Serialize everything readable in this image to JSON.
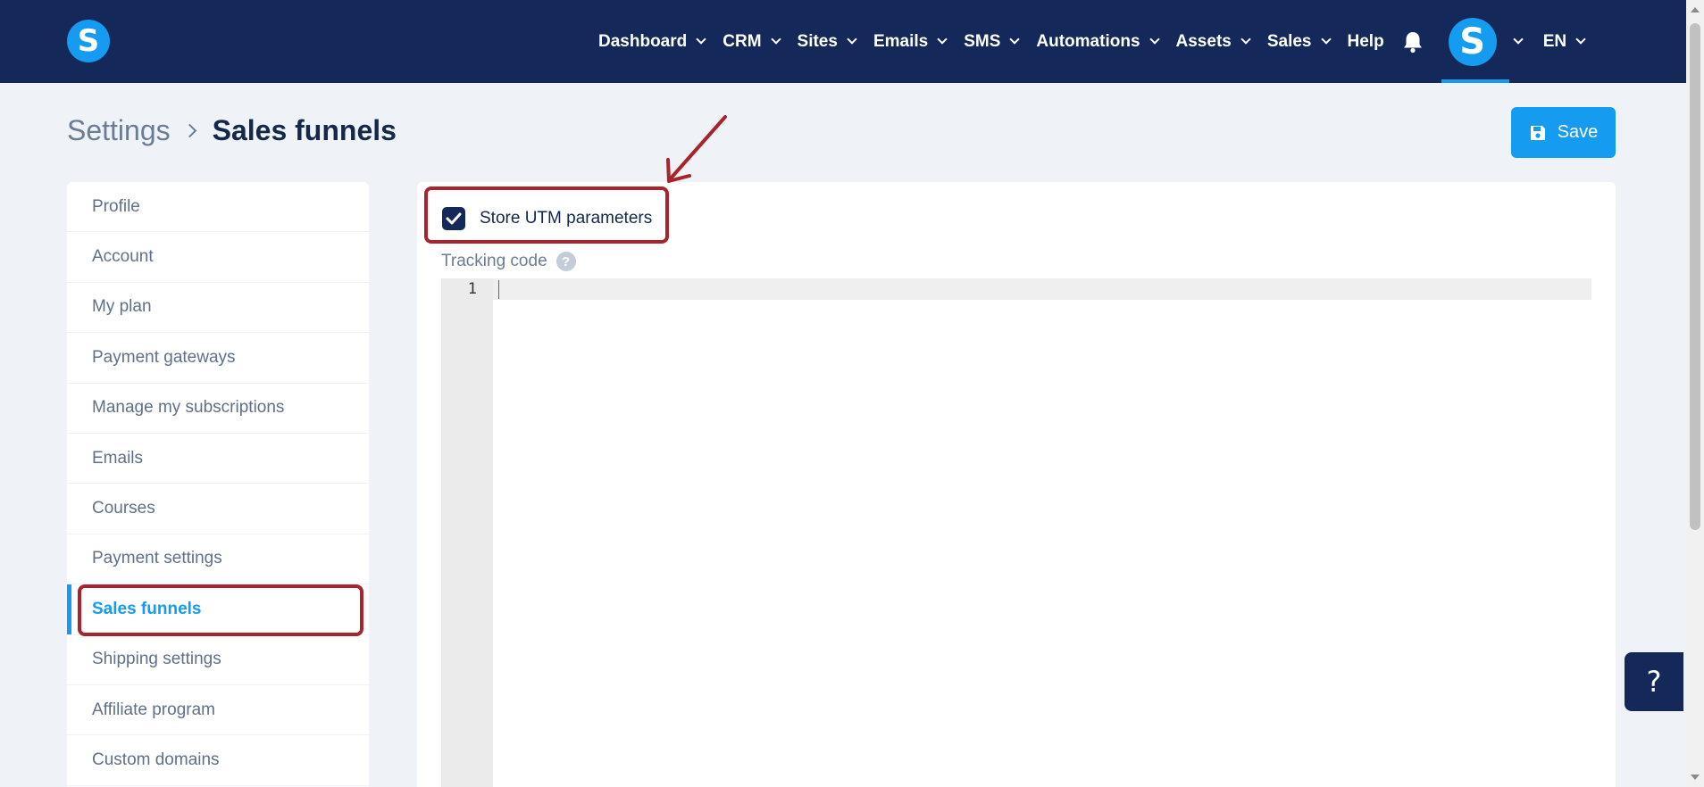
{
  "header": {
    "logo_letter": "S",
    "nav": [
      {
        "label": "Dashboard",
        "dropdown": true
      },
      {
        "label": "CRM",
        "dropdown": true
      },
      {
        "label": "Sites",
        "dropdown": true
      },
      {
        "label": "Emails",
        "dropdown": true
      },
      {
        "label": "SMS",
        "dropdown": true
      },
      {
        "label": "Automations",
        "dropdown": true
      },
      {
        "label": "Assets",
        "dropdown": true
      },
      {
        "label": "Sales",
        "dropdown": true
      },
      {
        "label": "Help",
        "dropdown": false
      }
    ],
    "notification_icon": "bell-icon",
    "avatar_letter": "S",
    "language": "EN"
  },
  "breadcrumb": {
    "parent": "Settings",
    "current": "Sales funnels"
  },
  "toolbar": {
    "save_label": "Save",
    "save_icon": "floppy-disk-icon"
  },
  "sidebar": {
    "items": [
      {
        "label": "Profile",
        "active": false
      },
      {
        "label": "Account",
        "active": false
      },
      {
        "label": "My plan",
        "active": false
      },
      {
        "label": "Payment gateways",
        "active": false
      },
      {
        "label": "Manage my subscriptions",
        "active": false
      },
      {
        "label": "Emails",
        "active": false
      },
      {
        "label": "Courses",
        "active": false
      },
      {
        "label": "Payment settings",
        "active": false
      },
      {
        "label": "Sales funnels",
        "active": true
      },
      {
        "label": "Shipping settings",
        "active": false
      },
      {
        "label": "Affiliate program",
        "active": false
      },
      {
        "label": "Custom domains",
        "active": false
      }
    ]
  },
  "main": {
    "store_utm": {
      "label": "Store UTM parameters",
      "checked": true
    },
    "tracking_code": {
      "label": "Tracking code",
      "help_glyph": "?",
      "line_number": "1",
      "value": ""
    }
  },
  "floating_help": {
    "glyph": "?"
  },
  "colors": {
    "nav_bg": "#14295a",
    "accent": "#159bf0",
    "highlight_border": "#a8232b",
    "page_bg": "#eff3f8"
  }
}
